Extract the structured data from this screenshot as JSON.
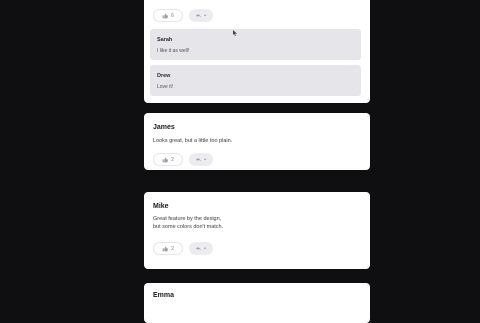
{
  "cards": [
    {
      "like_count": "6",
      "reply_label": "•",
      "replies": [
        {
          "author": "Sarah",
          "text": "I like it as well!"
        },
        {
          "author": "Drew",
          "text": "Love it!"
        }
      ]
    },
    {
      "author": "James",
      "text": "Looks great, but a little too plain.",
      "like_count": "2",
      "reply_label": "•"
    },
    {
      "author": "Mike",
      "text": "Great feature by the design,\nbut some colors don't match.",
      "like_count": "2",
      "reply_label": "•"
    },
    {
      "author": "Emma"
    }
  ],
  "icons": {
    "like": "thumbs-up-icon",
    "reply": "reply-icon"
  },
  "colors": {
    "page_background": "#0f0e10",
    "card_background": "#ffffff",
    "reply_background": "#e6e6ea"
  }
}
